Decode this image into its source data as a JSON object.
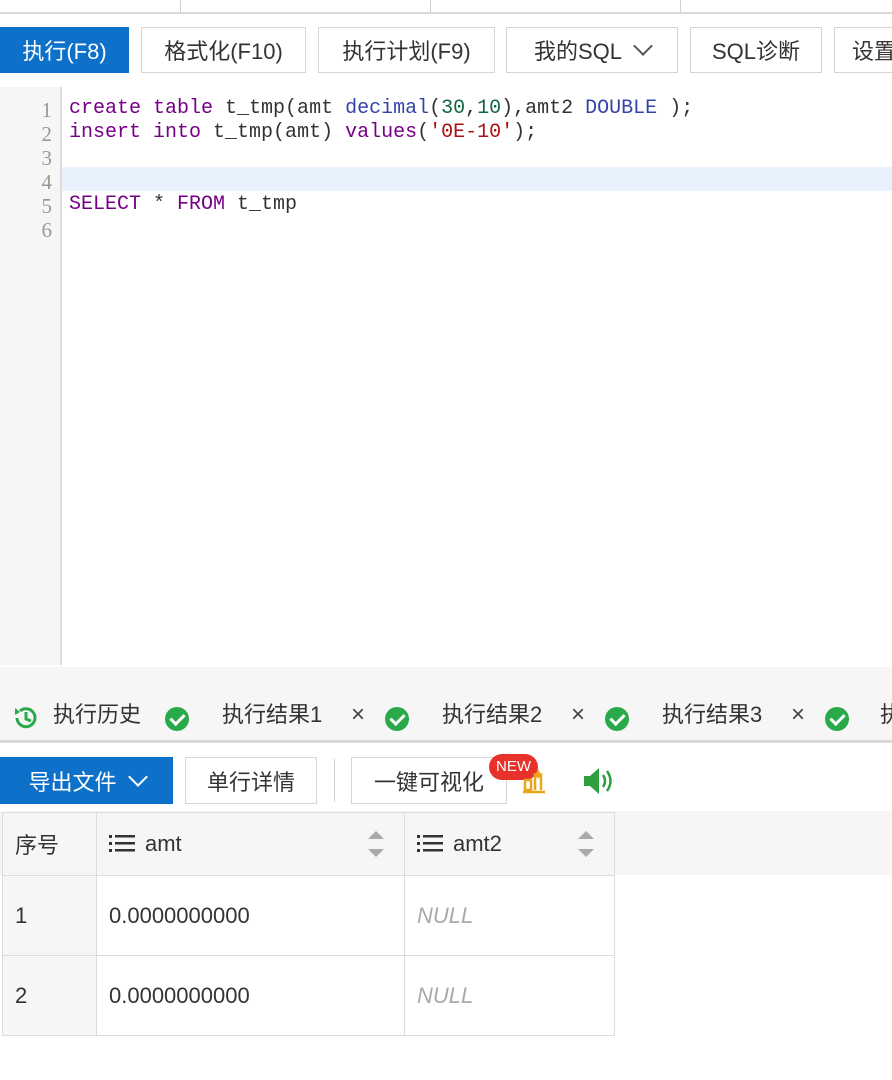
{
  "toolbar": {
    "run_label": "执行(F8)",
    "format_label": "格式化(F10)",
    "plan_label": "执行计划(F9)",
    "my_sql_label": "我的SQL",
    "diagnose_label": "SQL诊断",
    "settings_label": "设置"
  },
  "editor": {
    "line_numbers": [
      "1",
      "2",
      "3",
      "4",
      "5",
      "6"
    ],
    "line1": {
      "kw1": "create",
      "kw2": "table",
      "t1": " t_tmp(amt ",
      "ty1": "decimal",
      "t2": "(",
      "n1": "30",
      "t3": ",",
      "n2": "10",
      "t4": "),amt2 ",
      "ty2": "DOUBLE",
      "t5": " );"
    },
    "line2": {
      "kw1": "insert",
      "kw2": "into",
      "t1": " t_tmp(amt) ",
      "kw3": "values",
      "t2": "(",
      "s1": "'0E-10'",
      "t3": ");"
    },
    "line5": {
      "kw1": "SELECT",
      "t1": " * ",
      "kw2": "FROM",
      "t2": " t_tmp"
    }
  },
  "result_tabs": [
    {
      "label": "执行历史"
    },
    {
      "label": "执行结果1"
    },
    {
      "label": "执行结果2"
    },
    {
      "label": "执行结果3"
    },
    {
      "label": "执"
    }
  ],
  "result_toolbar": {
    "export_label": "导出文件",
    "row_detail_label": "单行详情",
    "visualize_label": "一键可视化",
    "new_badge": "NEW"
  },
  "table": {
    "columns": [
      "序号",
      "amt",
      "amt2"
    ],
    "rows": [
      [
        "1",
        "0.0000000000",
        "NULL"
      ],
      [
        "2",
        "0.0000000000",
        "NULL"
      ]
    ]
  }
}
